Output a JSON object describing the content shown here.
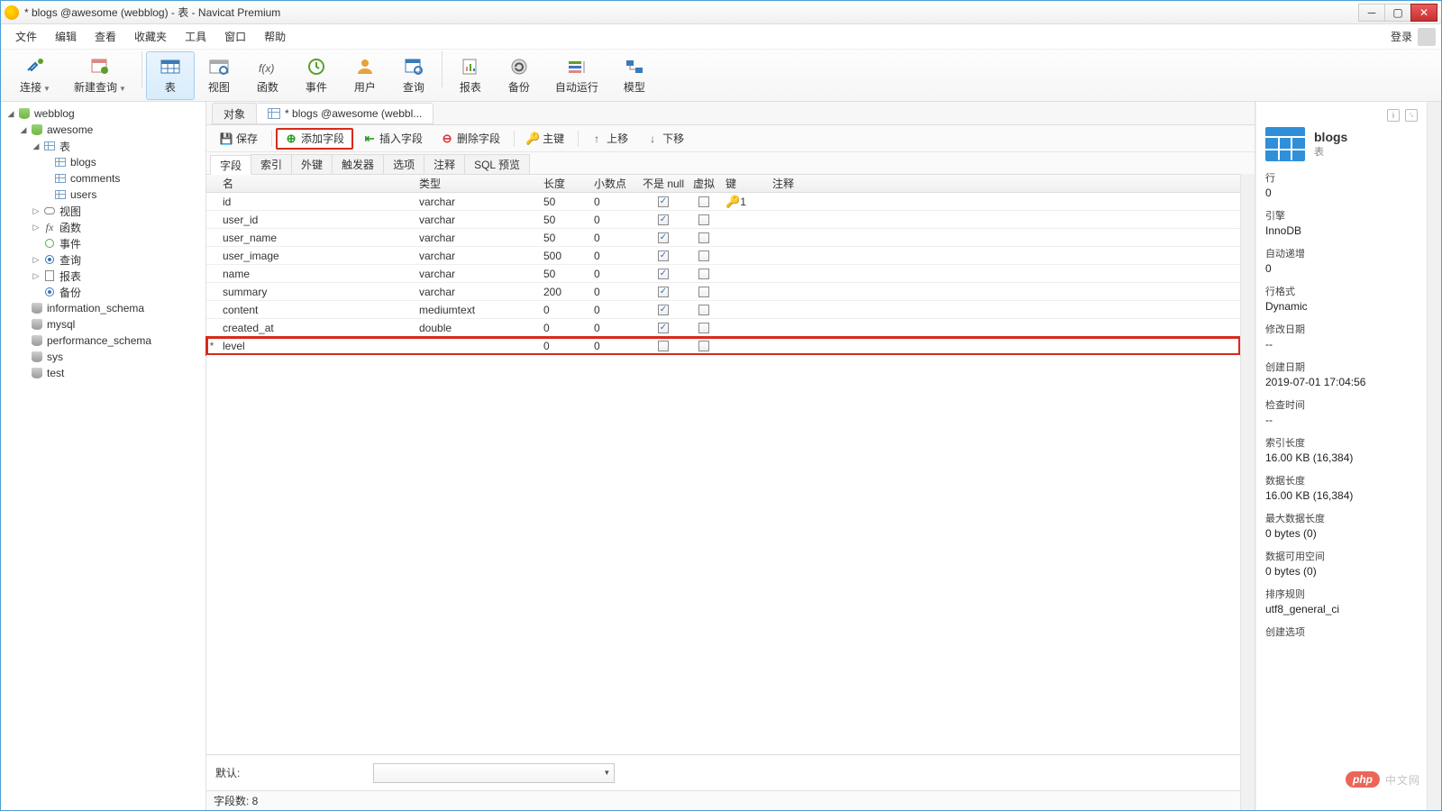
{
  "window": {
    "title": "* blogs @awesome (webblog) - 表 - Navicat Premium"
  },
  "menu": {
    "items": [
      "文件",
      "编辑",
      "查看",
      "收藏夹",
      "工具",
      "窗口",
      "帮助"
    ],
    "login": "登录"
  },
  "toolbar": {
    "items": [
      {
        "label": "连接",
        "icon": "plug"
      },
      {
        "label": "新建查询",
        "icon": "query"
      },
      {
        "label": "表",
        "icon": "table",
        "active": true
      },
      {
        "label": "视图",
        "icon": "view"
      },
      {
        "label": "函数",
        "icon": "fx"
      },
      {
        "label": "事件",
        "icon": "clock"
      },
      {
        "label": "用户",
        "icon": "user"
      },
      {
        "label": "查询",
        "icon": "query2"
      },
      {
        "label": "报表",
        "icon": "report"
      },
      {
        "label": "备份",
        "icon": "backup"
      },
      {
        "label": "自动运行",
        "icon": "autorun"
      },
      {
        "label": "模型",
        "icon": "model"
      }
    ]
  },
  "tree": {
    "conn": "webblog",
    "db": "awesome",
    "groups": {
      "table": "表",
      "view": "视图",
      "func": "函数",
      "event": "事件",
      "query": "查询",
      "report": "报表",
      "backup": "备份"
    },
    "tables": [
      "blogs",
      "comments",
      "users"
    ],
    "others": [
      "information_schema",
      "mysql",
      "performance_schema",
      "sys",
      "test"
    ]
  },
  "doctabs": {
    "objects": "对象",
    "current": "* blogs @awesome (webbl..."
  },
  "actions": {
    "save": "保存",
    "add": "添加字段",
    "insert": "插入字段",
    "delete": "删除字段",
    "pkey": "主键",
    "up": "上移",
    "down": "下移"
  },
  "designtabs": [
    "字段",
    "索引",
    "外键",
    "触发器",
    "选项",
    "注释",
    "SQL 预览"
  ],
  "columns": {
    "name": "名",
    "type": "类型",
    "len": "长度",
    "dec": "小数点",
    "nn": "不是 null",
    "virt": "虚拟",
    "key": "键",
    "comment": "注释"
  },
  "fields": [
    {
      "name": "id",
      "type": "varchar",
      "len": "50",
      "dec": "0",
      "nn": true,
      "virt": false,
      "key": "1",
      "mark": ""
    },
    {
      "name": "user_id",
      "type": "varchar",
      "len": "50",
      "dec": "0",
      "nn": true,
      "virt": false,
      "key": "",
      "mark": ""
    },
    {
      "name": "user_name",
      "type": "varchar",
      "len": "50",
      "dec": "0",
      "nn": true,
      "virt": false,
      "key": "",
      "mark": ""
    },
    {
      "name": "user_image",
      "type": "varchar",
      "len": "500",
      "dec": "0",
      "nn": true,
      "virt": false,
      "key": "",
      "mark": ""
    },
    {
      "name": "name",
      "type": "varchar",
      "len": "50",
      "dec": "0",
      "nn": true,
      "virt": false,
      "key": "",
      "mark": ""
    },
    {
      "name": "summary",
      "type": "varchar",
      "len": "200",
      "dec": "0",
      "nn": true,
      "virt": false,
      "key": "",
      "mark": ""
    },
    {
      "name": "content",
      "type": "mediumtext",
      "len": "0",
      "dec": "0",
      "nn": true,
      "virt": false,
      "key": "",
      "mark": ""
    },
    {
      "name": "created_at",
      "type": "double",
      "len": "0",
      "dec": "0",
      "nn": true,
      "virt": false,
      "key": "",
      "mark": ""
    },
    {
      "name": "level",
      "type": "",
      "len": "0",
      "dec": "0",
      "nn": false,
      "virt": false,
      "key": "",
      "mark": "*",
      "hl": true
    }
  ],
  "bottom": {
    "default_label": "默认:"
  },
  "status": {
    "text": "字段数: 8"
  },
  "info": {
    "title": "blogs",
    "sub": "表",
    "props": [
      {
        "k": "行",
        "v": "0"
      },
      {
        "k": "引擎",
        "v": "InnoDB"
      },
      {
        "k": "自动递增",
        "v": "0"
      },
      {
        "k": "行格式",
        "v": "Dynamic"
      },
      {
        "k": "修改日期",
        "v": "--"
      },
      {
        "k": "创建日期",
        "v": "2019-07-01 17:04:56"
      },
      {
        "k": "检查时间",
        "v": "--"
      },
      {
        "k": "索引长度",
        "v": "16.00 KB (16,384)"
      },
      {
        "k": "数据长度",
        "v": "16.00 KB (16,384)"
      },
      {
        "k": "最大数据长度",
        "v": "0 bytes (0)"
      },
      {
        "k": "数据可用空间",
        "v": "0 bytes (0)"
      },
      {
        "k": "排序规则",
        "v": "utf8_general_ci"
      },
      {
        "k": "创建选项",
        "v": ""
      }
    ]
  },
  "watermark": {
    "badge": "php",
    "text": "中文网"
  }
}
